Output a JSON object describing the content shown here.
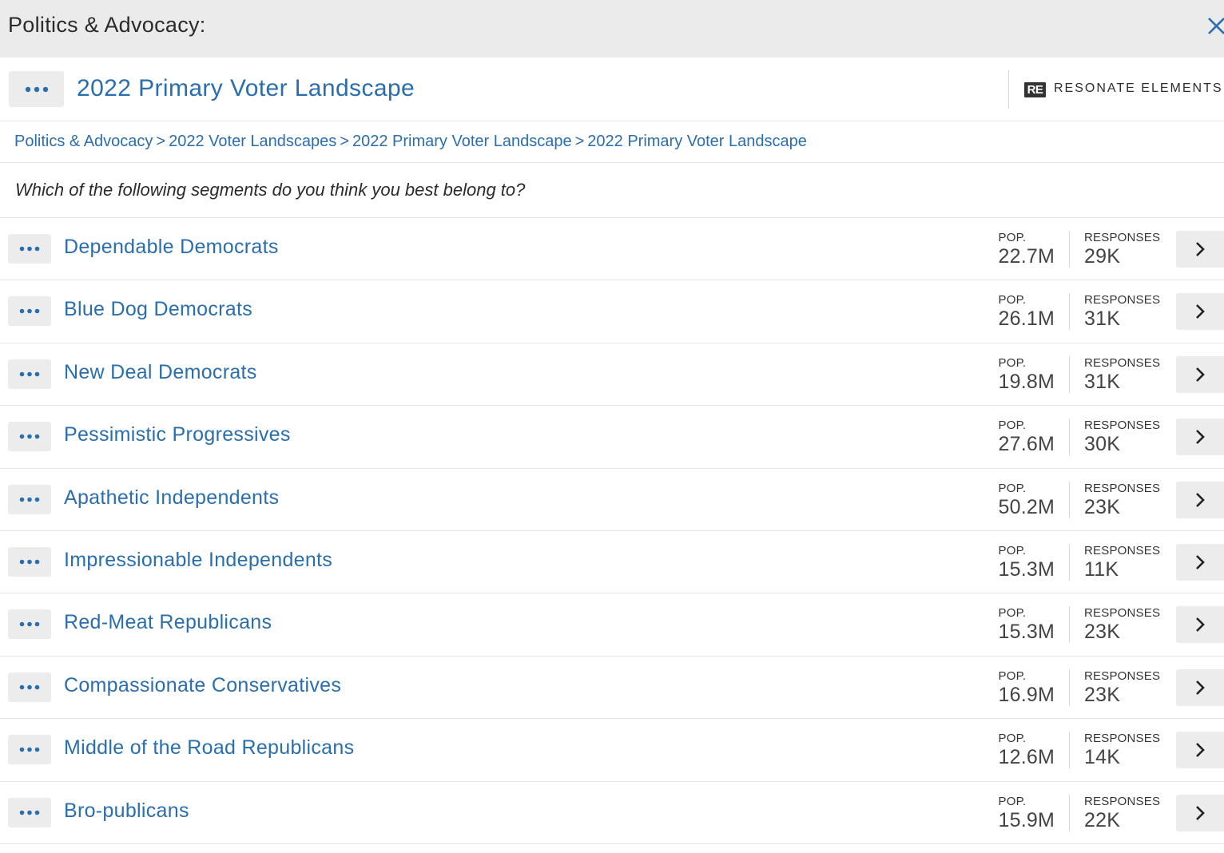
{
  "topbar": {
    "title": "Politics & Advocacy:",
    "close_icon": "close-icon"
  },
  "header": {
    "title": "2022 Primary Voter Landscape",
    "brand_logo": "RE",
    "brand_name": "RESONATE ELEMENTS"
  },
  "breadcrumb": {
    "items": [
      "Politics & Advocacy",
      "2022 Voter Landscapes",
      "2022 Primary Voter Landscape",
      "2022 Primary Voter Landscape"
    ],
    "separator": ">"
  },
  "question": "Which of the following segments do you think you best belong to?",
  "labels": {
    "pop": "POP.",
    "responses": "RESPONSES"
  },
  "colors": {
    "link": "#2a6ead",
    "topbar_bg": "#ebebeb",
    "button_bg": "#ececec"
  },
  "segments": [
    {
      "name": "Dependable Democrats",
      "pop": "22.7M",
      "responses": "29K"
    },
    {
      "name": "Blue Dog Democrats",
      "pop": "26.1M",
      "responses": "31K"
    },
    {
      "name": "New Deal Democrats",
      "pop": "19.8M",
      "responses": "31K"
    },
    {
      "name": "Pessimistic Progressives",
      "pop": "27.6M",
      "responses": "30K"
    },
    {
      "name": "Apathetic Independents",
      "pop": "50.2M",
      "responses": "23K"
    },
    {
      "name": "Impressionable Independents",
      "pop": "15.3M",
      "responses": "11K"
    },
    {
      "name": "Red-Meat Republicans",
      "pop": "15.3M",
      "responses": "23K"
    },
    {
      "name": "Compassionate Conservatives",
      "pop": "16.9M",
      "responses": "23K"
    },
    {
      "name": "Middle of the Road Republicans",
      "pop": "12.6M",
      "responses": "14K"
    },
    {
      "name": "Bro-publicans",
      "pop": "15.9M",
      "responses": "22K"
    }
  ]
}
